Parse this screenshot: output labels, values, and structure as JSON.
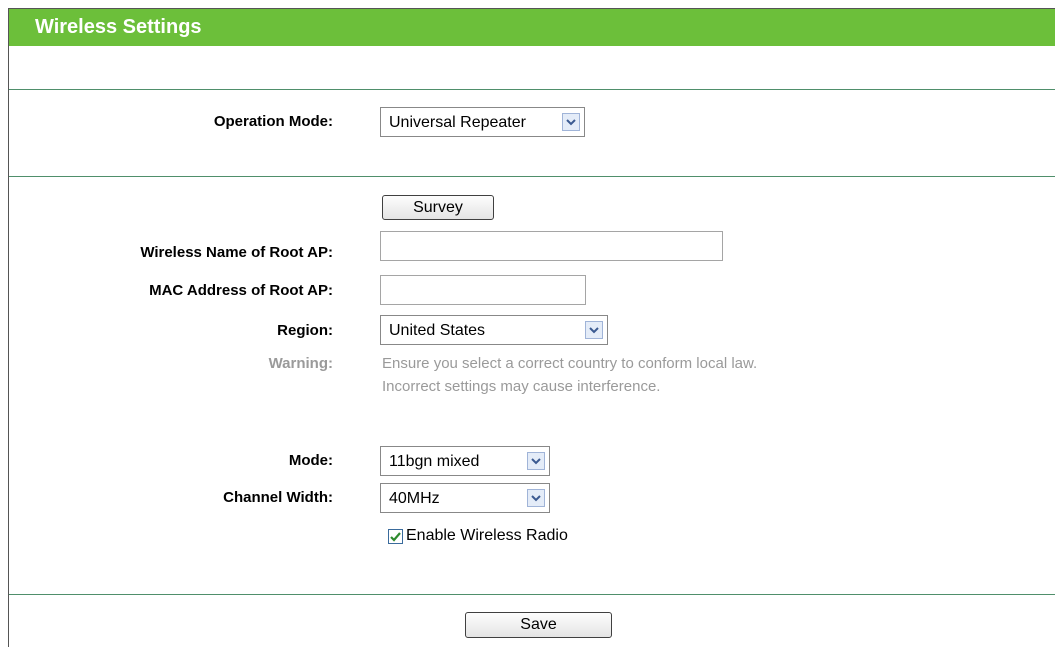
{
  "header": {
    "title": "Wireless Settings"
  },
  "operation_mode": {
    "label": "Operation Mode:",
    "value": "Universal Repeater"
  },
  "survey": {
    "button_label": "Survey"
  },
  "root_ap": {
    "name_label": "Wireless Name of Root AP:",
    "name_value": "",
    "mac_label": "MAC Address of Root AP:",
    "mac_value": ""
  },
  "region": {
    "label": "Region:",
    "value": "United States"
  },
  "warning": {
    "label": "Warning:",
    "line1": "Ensure you select a correct country to conform local law.",
    "line2": "Incorrect settings may cause interference."
  },
  "mode": {
    "label": "Mode:",
    "value": "11bgn mixed"
  },
  "channel_width": {
    "label": "Channel Width:",
    "value": "40MHz"
  },
  "wireless_radio": {
    "label": "Enable Wireless Radio",
    "checked": true
  },
  "footer": {
    "save_label": "Save"
  },
  "colors": {
    "header_bg": "#6cbf3a",
    "divider": "#4f8f6b",
    "warning_text": "#9a9a9a"
  }
}
